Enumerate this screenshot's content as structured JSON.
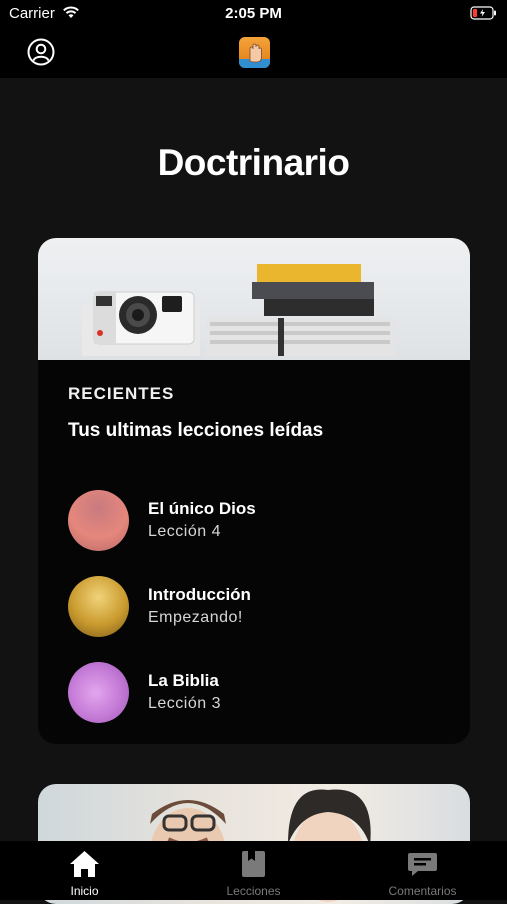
{
  "status_bar": {
    "carrier": "Carrier",
    "time": "2:05 PM"
  },
  "header": {
    "profile_icon": "person-circle-icon",
    "logo_icon": "app-logo-hand-icon"
  },
  "page": {
    "title": "Doctrinario"
  },
  "recent_card": {
    "eyebrow": "RECIENTES",
    "heading": "Tus ultimas lecciones leídas",
    "items": [
      {
        "title": "El único Dios",
        "subtitle": "Lección 4",
        "color": "#e07a72"
      },
      {
        "title": "Introducción",
        "subtitle": "Empezando!",
        "color": "#c99a2e"
      },
      {
        "title": "La Biblia",
        "subtitle": "Lección 3",
        "color": "#c47ad6"
      }
    ]
  },
  "tabbar": {
    "tabs": [
      {
        "label": "Inicio",
        "icon": "home-icon",
        "active": true
      },
      {
        "label": "Lecciones",
        "icon": "bookmark-book-icon",
        "active": false
      },
      {
        "label": "Comentarios",
        "icon": "chat-bubble-icon",
        "active": false
      }
    ]
  },
  "colors": {
    "background": "#121212",
    "card": "#050505",
    "active_tab": "#ffffff",
    "inactive_tab": "#7a7a7a"
  }
}
